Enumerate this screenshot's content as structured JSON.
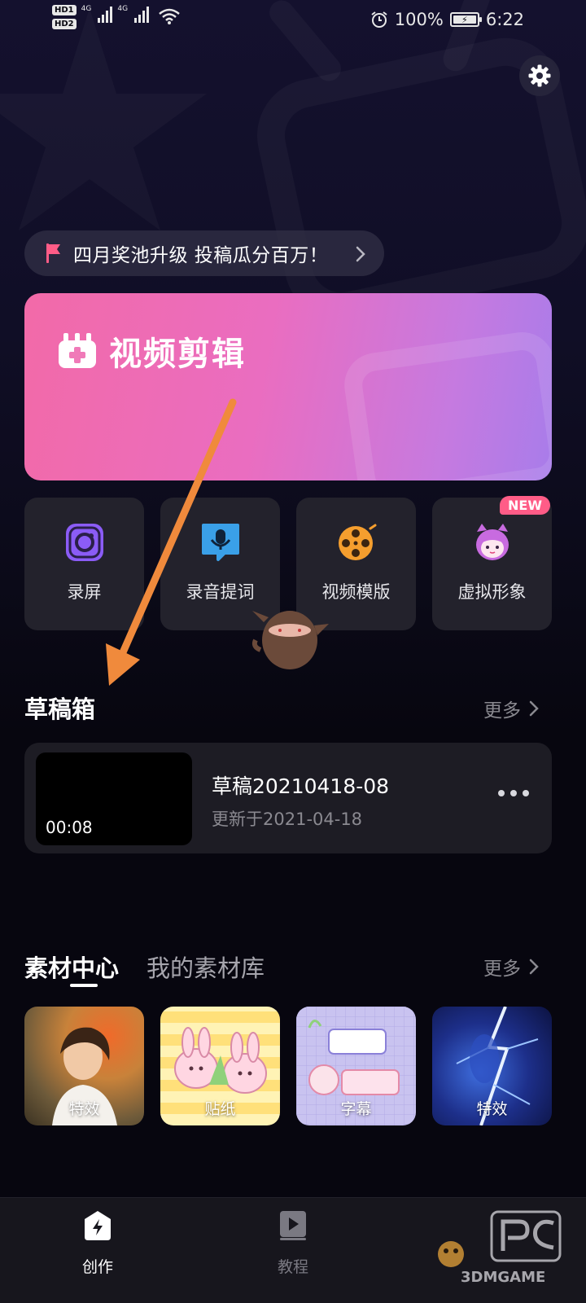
{
  "status_bar": {
    "sim1": "HD1",
    "sim2": "HD2",
    "net1": "4G",
    "net2": "4G",
    "battery": "100%",
    "time": "6:22"
  },
  "banner": {
    "text": "四月奖池升级 投稿瓜分百万！"
  },
  "hero": {
    "title": "视频剪辑"
  },
  "tools": [
    {
      "label": "录屏"
    },
    {
      "label": "录音提词"
    },
    {
      "label": "视频模版"
    },
    {
      "label": "虚拟形象",
      "badge": "NEW"
    }
  ],
  "drafts": {
    "title": "草稿箱",
    "more": "更多",
    "items": [
      {
        "duration": "00:08",
        "name": "草稿20210418-08",
        "updated": "更新于2021-04-18"
      }
    ]
  },
  "materials": {
    "tab_active": "素材中心",
    "tab_other": "我的素材库",
    "more": "更多",
    "items": [
      {
        "label": "特效"
      },
      {
        "label": "贴纸"
      },
      {
        "label": "字幕"
      },
      {
        "label": "特效"
      }
    ]
  },
  "bottom_nav": [
    {
      "label": "创作",
      "active": true
    },
    {
      "label": "教程",
      "active": false
    }
  ],
  "watermark": {
    "text": "3DMGAME"
  },
  "colors": {
    "background": "#07060f",
    "card": "#23222c",
    "accent_pink": "#f26aa8",
    "accent_purple": "#a87cea",
    "annotation_arrow": "#f08a3c",
    "muted_text": "#8a8990"
  }
}
